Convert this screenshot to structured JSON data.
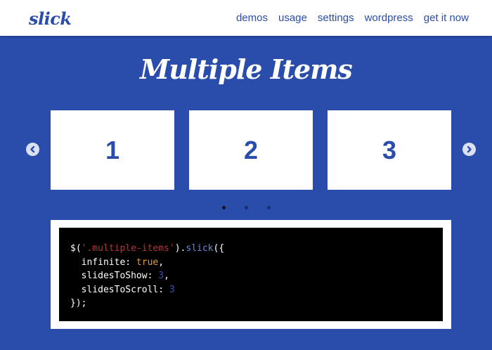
{
  "header": {
    "logo": "slick",
    "nav": [
      "demos",
      "usage",
      "settings",
      "wordpress",
      "get it now"
    ]
  },
  "heading": "Multiple Items",
  "slides": [
    "1",
    "2",
    "3"
  ],
  "dots_count": 3,
  "active_dot": 0,
  "code": {
    "line1": {
      "prefix": "$(",
      "selector": "'.multiple-items'",
      "suffix_open": ").",
      "method": "slick",
      "suffix": "({"
    },
    "line2": {
      "key": "  infinite: ",
      "value": "true",
      "end": ","
    },
    "line3": {
      "key": "  slidesToShow: ",
      "value": "3",
      "end": ","
    },
    "line4": {
      "key": "  slidesToScroll: ",
      "value": "3",
      "end": ""
    },
    "line5": "});"
  },
  "colors": {
    "background": "#2a4cab",
    "accent": "#2a4cab",
    "string": "#b0363d",
    "method": "#6f86d6",
    "keyword": "#e59a39",
    "number": "#3b4fb5"
  },
  "icons": {
    "prev": "chevron-left-icon",
    "next": "chevron-right-icon"
  }
}
